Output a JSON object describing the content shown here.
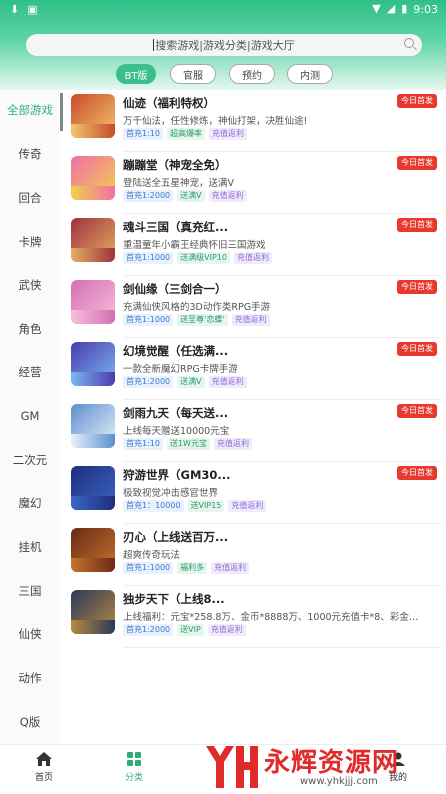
{
  "status_bar": {
    "time": "9:03"
  },
  "search": {
    "placeholder": "搜索游戏|游戏分类|游戏大厅"
  },
  "filters": [
    "BT版",
    "官服",
    "预约",
    "内测"
  ],
  "sidebar": {
    "items": [
      "全部游戏",
      "传奇",
      "回合",
      "卡牌",
      "武侠",
      "角色",
      "经营",
      "GM",
      "二次元",
      "魔幻",
      "挂机",
      "三国",
      "仙侠",
      "动作",
      "Q版"
    ]
  },
  "games": [
    {
      "title": "仙迹（福利特权）",
      "desc": "万千仙法，任性修炼，神仙打架，决胜仙途!",
      "tags": [
        "首充1:10",
        "超高爆率",
        "充值返利"
      ],
      "badge": "今日首发",
      "colors": [
        "#c84a2d",
        "#f3c66b"
      ]
    },
    {
      "title": "蹦蹦堂（神宠全免）",
      "desc": "登陆送全五星神宠，送满V",
      "tags": [
        "首充1:2000",
        "送满V",
        "充值返利"
      ],
      "badge": "今日首发",
      "colors": [
        "#f06fa8",
        "#f2d04a"
      ]
    },
    {
      "title": "魂斗三国（真充红...",
      "desc": "重温童年小霸王经典怀旧三国游戏",
      "tags": [
        "首充1:1000",
        "送满级VIP10",
        "充值返利"
      ],
      "badge": "今日首发",
      "colors": [
        "#a03040",
        "#e3b063"
      ]
    },
    {
      "title": "剑仙缘（三剑合一）",
      "desc": "充满仙侠风格的3D动作类RPG手游",
      "tags": [
        "首充1:1000",
        "送至尊'恋蝶'",
        "充值返利"
      ],
      "badge": "今日首发",
      "colors": [
        "#d46fb5",
        "#f6c0d8"
      ]
    },
    {
      "title": "幻境觉醒（任选满...",
      "desc": "一款全新魔幻RPG卡牌手游",
      "tags": [
        "首充1:2000",
        "送满V",
        "充值返利"
      ],
      "badge": "今日首发",
      "colors": [
        "#4a3bb0",
        "#7db7ef"
      ]
    },
    {
      "title": "剑雨九天（每天送...",
      "desc": "上线每天赠送10000元宝",
      "tags": [
        "首充1:10",
        "送1W元宝",
        "充值返利"
      ],
      "badge": "今日首发",
      "colors": [
        "#5c8fcf",
        "#eaf1fa"
      ]
    },
    {
      "title": "狩游世界（GM30...",
      "desc": "极致视觉冲击感官世界",
      "tags": [
        "首充1：10000",
        "送VIP15",
        "充值返利"
      ],
      "badge": "今日首发",
      "colors": [
        "#1f2e7a",
        "#3b66c7"
      ]
    },
    {
      "title": "刃心（上线送百万...",
      "desc": "超爽传奇玩法",
      "tags": [
        "首充1:1000",
        "福利多",
        "充值返利"
      ],
      "badge": "",
      "colors": [
        "#6b2a18",
        "#c7722e"
      ]
    },
    {
      "title": "独步天下（上线8...",
      "desc": "上线福利：元宝*258.8万、金币*8888万、1000元充值卡*8、彩金伙伴...",
      "tags": [
        "首充1:2000",
        "送VIP",
        "充值返利"
      ],
      "badge": "",
      "colors": [
        "#2b3a5a",
        "#b8893f"
      ]
    }
  ],
  "bottom_nav": [
    "首页",
    "分类",
    "",
    "",
    "我的"
  ],
  "watermark": {
    "text": "永辉资源网",
    "url": "www.yhkjjj.com"
  }
}
